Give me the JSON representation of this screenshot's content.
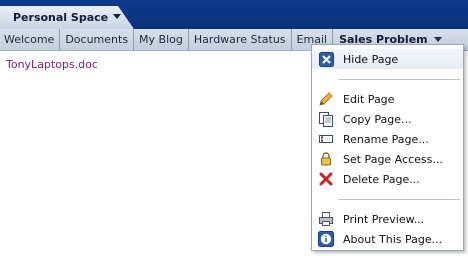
{
  "personal_space": {
    "label": "Personal Space"
  },
  "tabs": [
    {
      "label": "Welcome"
    },
    {
      "label": "Documents"
    },
    {
      "label": "My Blog"
    },
    {
      "label": "Hardware Status"
    },
    {
      "label": "Email"
    }
  ],
  "active_tab": {
    "label": "Sales Problem"
  },
  "content": {
    "document_link": "TonyLaptops.doc"
  },
  "menu": {
    "hide_page": "Hide Page",
    "edit_page": "Edit Page",
    "copy_page": "Copy Page...",
    "rename_page": "Rename Page...",
    "set_page_access": "Set Page Access...",
    "delete_page": "Delete Page...",
    "print_preview": "Print Preview...",
    "about_page": "About This Page..."
  },
  "icons": {
    "hide": "close-box-icon",
    "edit": "pencil-icon",
    "copy": "copy-pages-icon",
    "rename": "rename-icon",
    "access": "padlock-icon",
    "delete": "red-x-icon",
    "print": "printer-icon",
    "about": "info-icon"
  }
}
